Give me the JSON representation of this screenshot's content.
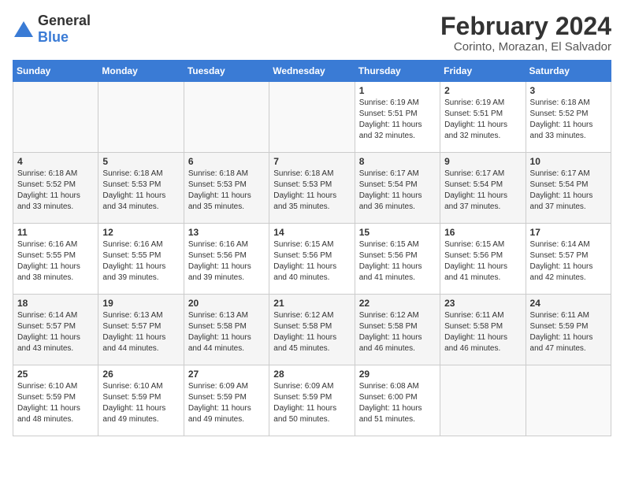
{
  "logo": {
    "general": "General",
    "blue": "Blue"
  },
  "title": "February 2024",
  "subtitle": "Corinto, Morazan, El Salvador",
  "days_of_week": [
    "Sunday",
    "Monday",
    "Tuesday",
    "Wednesday",
    "Thursday",
    "Friday",
    "Saturday"
  ],
  "weeks": [
    [
      {
        "day": "",
        "info": ""
      },
      {
        "day": "",
        "info": ""
      },
      {
        "day": "",
        "info": ""
      },
      {
        "day": "",
        "info": ""
      },
      {
        "day": "1",
        "info": "Sunrise: 6:19 AM\nSunset: 5:51 PM\nDaylight: 11 hours\nand 32 minutes."
      },
      {
        "day": "2",
        "info": "Sunrise: 6:19 AM\nSunset: 5:51 PM\nDaylight: 11 hours\nand 32 minutes."
      },
      {
        "day": "3",
        "info": "Sunrise: 6:18 AM\nSunset: 5:52 PM\nDaylight: 11 hours\nand 33 minutes."
      }
    ],
    [
      {
        "day": "4",
        "info": "Sunrise: 6:18 AM\nSunset: 5:52 PM\nDaylight: 11 hours\nand 33 minutes."
      },
      {
        "day": "5",
        "info": "Sunrise: 6:18 AM\nSunset: 5:53 PM\nDaylight: 11 hours\nand 34 minutes."
      },
      {
        "day": "6",
        "info": "Sunrise: 6:18 AM\nSunset: 5:53 PM\nDaylight: 11 hours\nand 35 minutes."
      },
      {
        "day": "7",
        "info": "Sunrise: 6:18 AM\nSunset: 5:53 PM\nDaylight: 11 hours\nand 35 minutes."
      },
      {
        "day": "8",
        "info": "Sunrise: 6:17 AM\nSunset: 5:54 PM\nDaylight: 11 hours\nand 36 minutes."
      },
      {
        "day": "9",
        "info": "Sunrise: 6:17 AM\nSunset: 5:54 PM\nDaylight: 11 hours\nand 37 minutes."
      },
      {
        "day": "10",
        "info": "Sunrise: 6:17 AM\nSunset: 5:54 PM\nDaylight: 11 hours\nand 37 minutes."
      }
    ],
    [
      {
        "day": "11",
        "info": "Sunrise: 6:16 AM\nSunset: 5:55 PM\nDaylight: 11 hours\nand 38 minutes."
      },
      {
        "day": "12",
        "info": "Sunrise: 6:16 AM\nSunset: 5:55 PM\nDaylight: 11 hours\nand 39 minutes."
      },
      {
        "day": "13",
        "info": "Sunrise: 6:16 AM\nSunset: 5:56 PM\nDaylight: 11 hours\nand 39 minutes."
      },
      {
        "day": "14",
        "info": "Sunrise: 6:15 AM\nSunset: 5:56 PM\nDaylight: 11 hours\nand 40 minutes."
      },
      {
        "day": "15",
        "info": "Sunrise: 6:15 AM\nSunset: 5:56 PM\nDaylight: 11 hours\nand 41 minutes."
      },
      {
        "day": "16",
        "info": "Sunrise: 6:15 AM\nSunset: 5:56 PM\nDaylight: 11 hours\nand 41 minutes."
      },
      {
        "day": "17",
        "info": "Sunrise: 6:14 AM\nSunset: 5:57 PM\nDaylight: 11 hours\nand 42 minutes."
      }
    ],
    [
      {
        "day": "18",
        "info": "Sunrise: 6:14 AM\nSunset: 5:57 PM\nDaylight: 11 hours\nand 43 minutes."
      },
      {
        "day": "19",
        "info": "Sunrise: 6:13 AM\nSunset: 5:57 PM\nDaylight: 11 hours\nand 44 minutes."
      },
      {
        "day": "20",
        "info": "Sunrise: 6:13 AM\nSunset: 5:58 PM\nDaylight: 11 hours\nand 44 minutes."
      },
      {
        "day": "21",
        "info": "Sunrise: 6:12 AM\nSunset: 5:58 PM\nDaylight: 11 hours\nand 45 minutes."
      },
      {
        "day": "22",
        "info": "Sunrise: 6:12 AM\nSunset: 5:58 PM\nDaylight: 11 hours\nand 46 minutes."
      },
      {
        "day": "23",
        "info": "Sunrise: 6:11 AM\nSunset: 5:58 PM\nDaylight: 11 hours\nand 46 minutes."
      },
      {
        "day": "24",
        "info": "Sunrise: 6:11 AM\nSunset: 5:59 PM\nDaylight: 11 hours\nand 47 minutes."
      }
    ],
    [
      {
        "day": "25",
        "info": "Sunrise: 6:10 AM\nSunset: 5:59 PM\nDaylight: 11 hours\nand 48 minutes."
      },
      {
        "day": "26",
        "info": "Sunrise: 6:10 AM\nSunset: 5:59 PM\nDaylight: 11 hours\nand 49 minutes."
      },
      {
        "day": "27",
        "info": "Sunrise: 6:09 AM\nSunset: 5:59 PM\nDaylight: 11 hours\nand 49 minutes."
      },
      {
        "day": "28",
        "info": "Sunrise: 6:09 AM\nSunset: 5:59 PM\nDaylight: 11 hours\nand 50 minutes."
      },
      {
        "day": "29",
        "info": "Sunrise: 6:08 AM\nSunset: 6:00 PM\nDaylight: 11 hours\nand 51 minutes."
      },
      {
        "day": "",
        "info": ""
      },
      {
        "day": "",
        "info": ""
      }
    ]
  ]
}
